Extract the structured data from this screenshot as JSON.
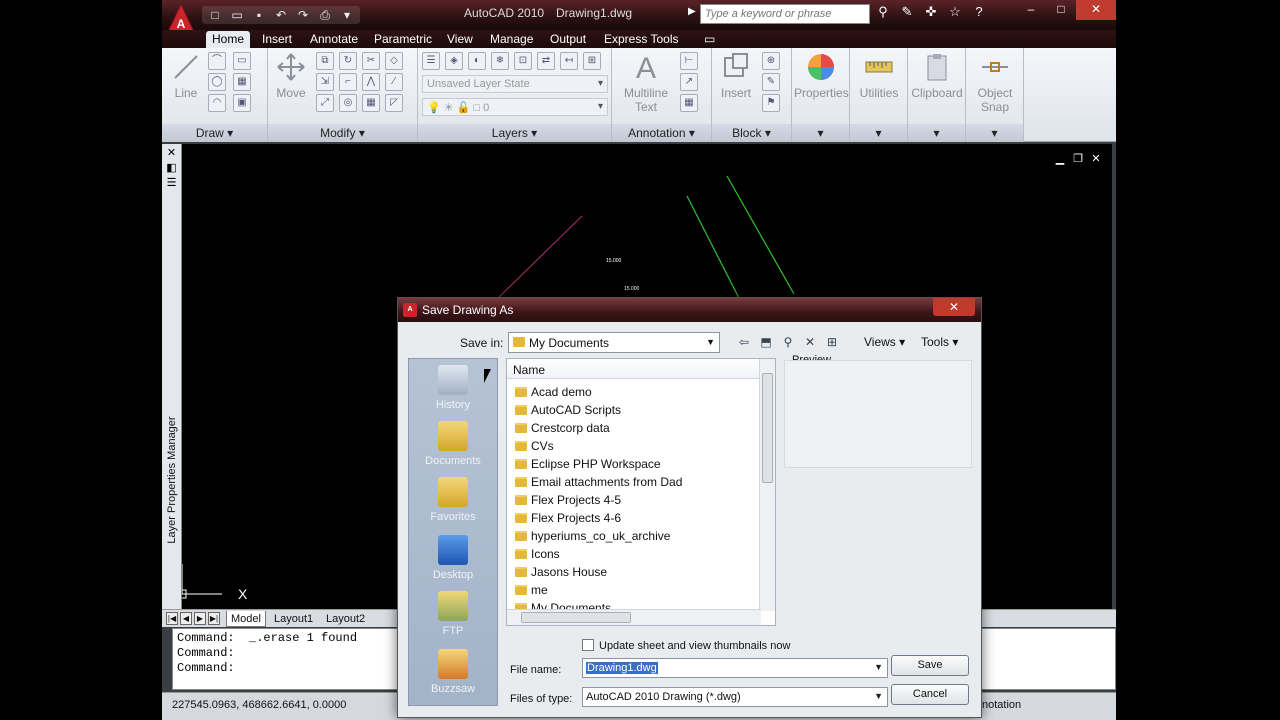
{
  "titlebar": {
    "app_title": "AutoCAD 2010",
    "doc_title": "Drawing1.dwg",
    "search_placeholder": "Type a keyword or phrase"
  },
  "ribbon": {
    "tabs": [
      "Home",
      "Insert",
      "Annotate",
      "Parametric",
      "View",
      "Manage",
      "Output",
      "Express Tools"
    ],
    "draw": {
      "line_label": "Line",
      "panel_title": "Draw"
    },
    "modify": {
      "move_label": "Move",
      "panel_title": "Modify"
    },
    "layers": {
      "layer_state": "Unsaved Layer State",
      "current_layer": "0",
      "panel_title": "Layers"
    },
    "annotation": {
      "mtext_label_1": "Multiline",
      "mtext_label_2": "Text",
      "panel_title": "Annotation"
    },
    "block": {
      "insert_label": "Insert",
      "panel_title": "Block"
    },
    "properties_label": "Properties",
    "utilities_label": "Utilities",
    "clipboard_label": "Clipboard",
    "osnap_label_1": "Object",
    "osnap_label_2": "Snap"
  },
  "drawing": {
    "dim_1": "15.000",
    "dim_2": "15.000",
    "palette_label": "Layer Properties Manager"
  },
  "layout_tabs": [
    "Model",
    "Layout1",
    "Layout2"
  ],
  "command_lines": [
    "Command:  _.erase 1 found",
    "Command:",
    "Command:"
  ],
  "status": {
    "coords": "227545.0963, 468662.6641, 0.0000",
    "annotation_scale": "notation"
  },
  "dialog": {
    "title": "Save Drawing As",
    "save_in_label": "Save in:",
    "save_in_value": "My Documents",
    "views_menu": "Views",
    "tools_menu": "Tools",
    "preview_label": "Preview",
    "places": [
      "History",
      "Documents",
      "Favorites",
      "Desktop",
      "FTP",
      "Buzzsaw"
    ],
    "column_name": "Name",
    "files": [
      "Acad demo",
      "AutoCAD Scripts",
      "Crestcorp data",
      "CVs",
      "Eclipse PHP Workspace",
      "Email attachments from Dad",
      "Flex Projects 4-5",
      "Flex Projects 4-6",
      "hyperiums_co_uk_archive",
      "Icons",
      "Jasons House",
      "me",
      "My Documents"
    ],
    "update_thumbnails_label": "Update sheet and view thumbnails now",
    "file_name_label": "File name:",
    "file_name_value": "Drawing1.dwg",
    "file_type_label": "Files of type:",
    "file_type_value": "AutoCAD 2010 Drawing (*.dwg)",
    "save_button": "Save",
    "cancel_button": "Cancel"
  }
}
